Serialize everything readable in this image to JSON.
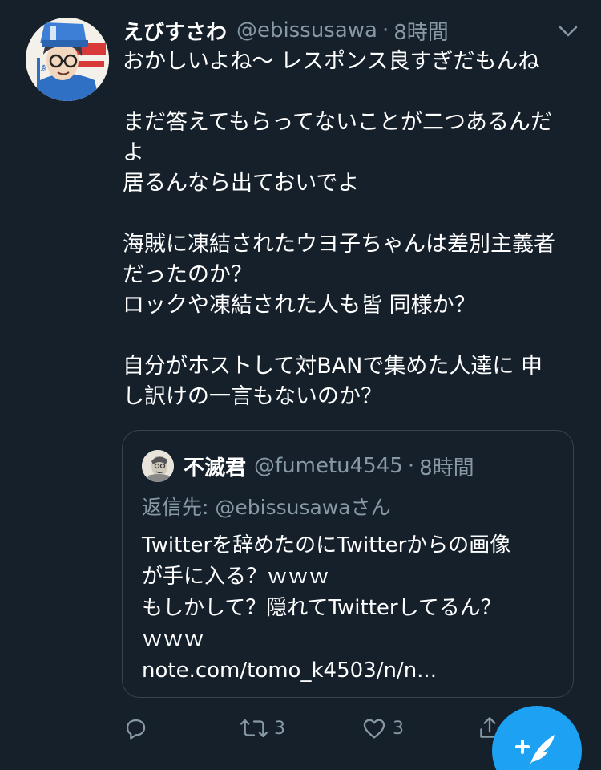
{
  "tweet": {
    "display_name": "えびすさわ",
    "handle": "@ebissusawa",
    "separator": "·",
    "time": "8時間",
    "body_lines": [
      "おかしいよね〜 レスポンス良すぎだもんね",
      "",
      "まだ答えてもらってないことが二つあるんだ",
      "よ",
      "居るんなら出ておいでよ",
      "",
      "海賊に凍結されたウヨ子ちゃんは差別主義者",
      "だったのか？",
      "ロックや凍結された人も皆 同様か？",
      "",
      "自分がホストして対BANで集めた人達に 申",
      "し訳けの一言もないのか？"
    ]
  },
  "quoted_tweet": {
    "display_name": "不滅君",
    "handle": "@fumetu4545",
    "separator": "·",
    "time": "8時間",
    "reply_prefix": "返信先: ",
    "reply_mention": "@ebissusawa",
    "reply_suffix": "さん",
    "body_lines": [
      "Twitterを辞めたのにTwitterからの画像",
      "が手に入る？ｗｗｗ",
      "もしかして？隠れてTwitterしてるん？",
      "ｗｗｗ",
      "note.com/tomo_k4503/n/n..."
    ]
  },
  "actions": {
    "reply_icon": "reply-icon",
    "retweet_icon": "retweet-icon",
    "retweet_count": "3",
    "like_icon": "heart-icon",
    "like_count": "3",
    "share_icon": "share-icon"
  },
  "fab": {
    "icon": "compose-tweet-icon"
  },
  "colors": {
    "background": "#15202b",
    "secondary_text": "#8899a6",
    "border": "#38444d",
    "accent": "#1da1f2"
  }
}
